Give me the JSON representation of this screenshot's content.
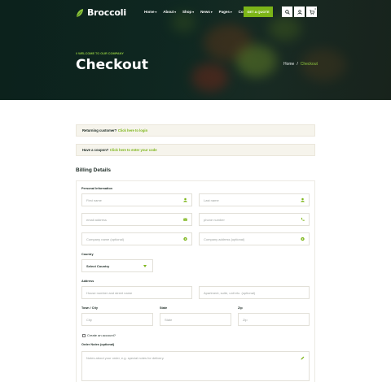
{
  "header": {
    "logo_text": "Broccoli",
    "nav": [
      {
        "label": "Home",
        "dropdown": true
      },
      {
        "label": "About",
        "dropdown": true
      },
      {
        "label": "Shop",
        "dropdown": true
      },
      {
        "label": "News",
        "dropdown": true
      },
      {
        "label": "Pages",
        "dropdown": true
      },
      {
        "label": "Contact",
        "dropdown": false
      }
    ],
    "cta_label": "GET A QUOTE",
    "cart_count": "0",
    "icons": [
      "search-icon",
      "user-icon",
      "cart-icon"
    ]
  },
  "hero": {
    "tagline": "// WELCOME TO OUR COMPANY",
    "title": "Checkout",
    "breadcrumb": {
      "home": "Home",
      "separator": "/",
      "current": "Checkout"
    }
  },
  "notices": {
    "returning": {
      "question": "Returning customer?",
      "link": "Click here to login"
    },
    "coupon": {
      "question": "Have a coupon?",
      "link": "Click here to enter your code"
    }
  },
  "billing": {
    "title": "Billing Details",
    "personal_label": "Personal Information",
    "first_name_placeholder": "First name",
    "last_name_placeholder": "Last name",
    "email_placeholder": "email address",
    "phone_placeholder": "phone number",
    "company_name_placeholder": "Company name (optional)",
    "company_address_placeholder": "Company address (optional)",
    "country_label": "Country",
    "country_value": "Select Country",
    "address_label": "Address",
    "street_placeholder": "House number and street name",
    "apartment_placeholder": "Apartment, suite, unit etc. (optional)",
    "town_label": "Town / City",
    "town_placeholder": "City",
    "state_label": "State",
    "state_placeholder": "State",
    "zip_label": "Zip",
    "zip_placeholder": "Zip",
    "create_account_label": "Create an account?",
    "order_notes_label": "Order Notes (optional)",
    "order_notes_placeholder": "Notes about your order, e.g. special notes for delivery."
  },
  "colors": {
    "accent": "#7cb518",
    "hero_bg": "#112b24",
    "notice_bg": "#f6f4ec",
    "text": "#1c2a24"
  }
}
